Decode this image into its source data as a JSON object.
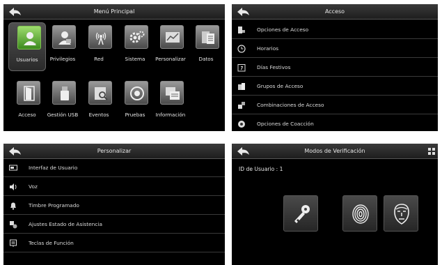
{
  "main_menu": {
    "title": "Menú Principal",
    "items": [
      {
        "label": "Usuarios",
        "icon": "user-icon",
        "selected": true
      },
      {
        "label": "Privilegios",
        "icon": "privilege-icon"
      },
      {
        "label": "Red",
        "icon": "network-icon"
      },
      {
        "label": "Sistema",
        "icon": "gear-icon"
      },
      {
        "label": "Personalizar",
        "icon": "personalize-icon"
      },
      {
        "label": "Datos",
        "icon": "data-icon"
      },
      {
        "label": "Acceso",
        "icon": "door-icon"
      },
      {
        "label": "Gestión USB",
        "icon": "usb-icon"
      },
      {
        "label": "Eventos",
        "icon": "events-icon"
      },
      {
        "label": "Pruebas",
        "icon": "test-icon"
      },
      {
        "label": "Información",
        "icon": "info-icon"
      }
    ]
  },
  "access": {
    "title": "Acceso",
    "items": [
      {
        "label": "Opciones de Acceso",
        "icon": "access-options-icon"
      },
      {
        "label": "Horarios",
        "icon": "clock-icon"
      },
      {
        "label": "Días Festivos",
        "icon": "calendar-icon"
      },
      {
        "label": "Grupos de Acceso",
        "icon": "group-icon"
      },
      {
        "label": "Combinaciones de Acceso",
        "icon": "combination-icon"
      },
      {
        "label": "Opciones de Coacción",
        "icon": "duress-icon"
      }
    ]
  },
  "personalize": {
    "title": "Personalizar",
    "items": [
      {
        "label": "Interfaz de Usuario",
        "icon": "monitor-icon"
      },
      {
        "label": "Voz",
        "icon": "speaker-icon"
      },
      {
        "label": "Timbre Programado",
        "icon": "bell-icon"
      },
      {
        "label": "Ajustes Estado de Asistencia",
        "icon": "attendance-icon"
      },
      {
        "label": "Teclas de Función",
        "icon": "function-key-icon"
      }
    ]
  },
  "verification": {
    "title": "Modos de Verificación",
    "user_id": "ID de Usuario : 1",
    "modes": [
      {
        "icon": "key-icon"
      },
      {
        "icon": "fingerprint-icon"
      },
      {
        "icon": "face-icon"
      }
    ]
  },
  "colors": {
    "screen_bg": "#000000",
    "header_bg": "#2a2a2a",
    "selected_tile": "#5cb034",
    "text": "#e6e6e6"
  }
}
